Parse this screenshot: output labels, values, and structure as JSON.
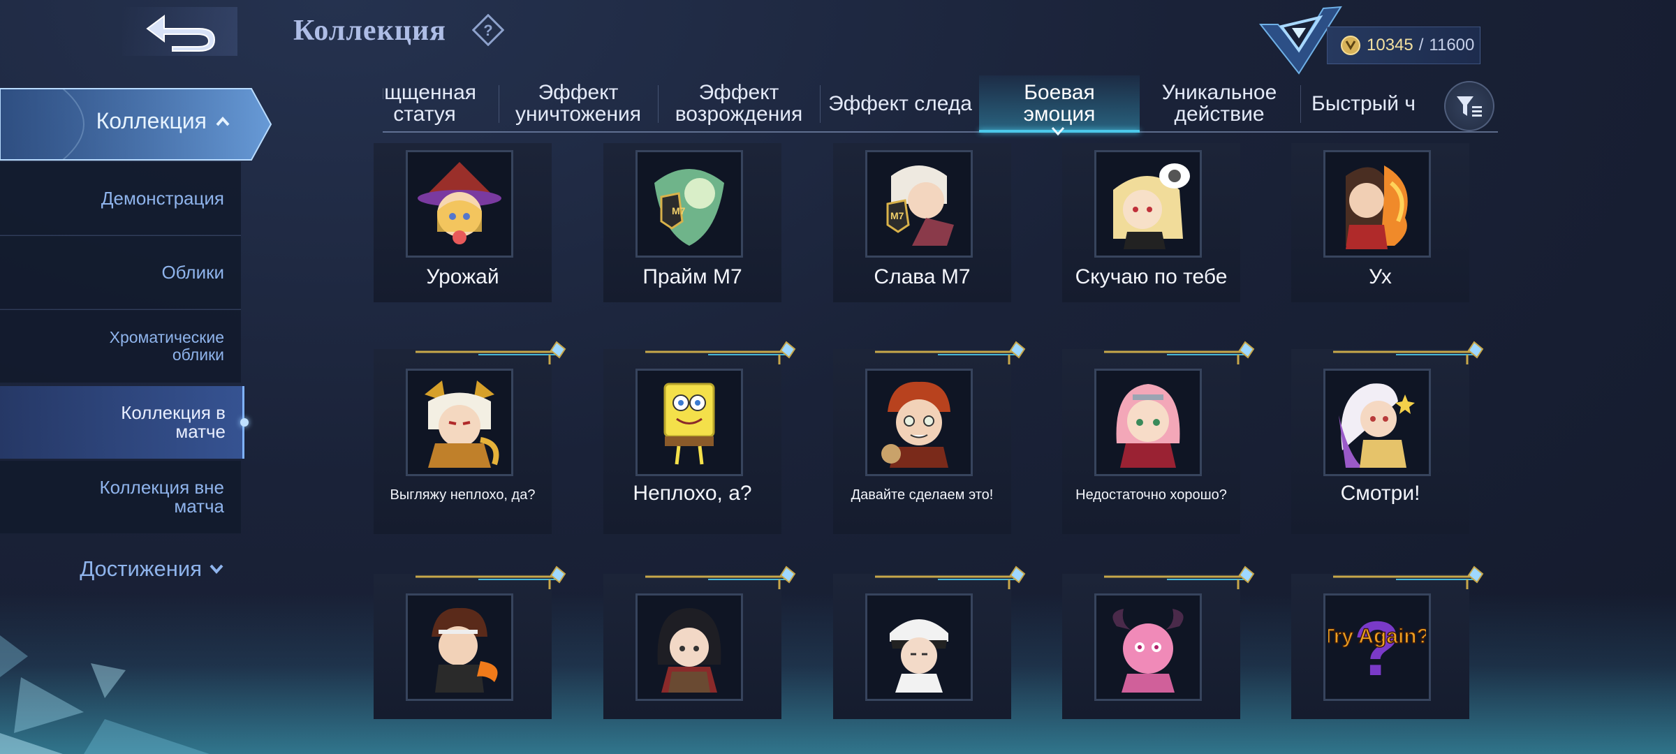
{
  "header": {
    "title": "Коллекция",
    "points_current": "10345",
    "points_separator": "/",
    "points_max": "11600"
  },
  "sidebar": {
    "active_section": "Коллекция",
    "items": [
      {
        "label": "Демонстрация"
      },
      {
        "label": "Облики"
      },
      {
        "label": "Хроматические облики"
      },
      {
        "label": "Коллекция в матче"
      },
      {
        "label": "Коллекция вне матча"
      }
    ],
    "achievements": "Достижения"
  },
  "tabs": [
    {
      "label": "ящщенная статуя"
    },
    {
      "label": "Эффект уничтожения"
    },
    {
      "label": "Эффект возрождения"
    },
    {
      "label": "Эффект следа"
    },
    {
      "label": "Боевая эмоция",
      "active": true
    },
    {
      "label": "Уникальное действие"
    },
    {
      "label": "Быстрый ч"
    }
  ],
  "emotes": [
    {
      "name": "Урожай",
      "icon": "witch-girl-sticker"
    },
    {
      "name": "Прайм М7",
      "icon": "m7-dragon-sticker"
    },
    {
      "name": "Слава М7",
      "icon": "m7-hero-sticker"
    },
    {
      "name": "Скучаю по тебе",
      "icon": "blonde-hero-sticker"
    },
    {
      "name": "Ух",
      "icon": "fire-hero-sticker"
    },
    {
      "name": "Выгляжу неплохо, да?",
      "icon": "oni-hero-sticker"
    },
    {
      "name": "Неплохо, а?",
      "icon": "spongebob-sticker"
    },
    {
      "name": "Давайте сделаем это!",
      "icon": "gaara-sticker"
    },
    {
      "name": "Недостаточно хорошо?",
      "icon": "sakura-sticker"
    },
    {
      "name": "Смотри!",
      "icon": "white-hair-hero-sticker"
    },
    {
      "name": "",
      "icon": "fire-fighter-sticker"
    },
    {
      "name": "",
      "icon": "mikasa-sticker"
    },
    {
      "name": "",
      "icon": "levi-sticker"
    },
    {
      "name": "",
      "icon": "pink-demon-sticker"
    },
    {
      "name": "",
      "icon": "try-again-sticker"
    }
  ],
  "try_again_text": "Try Again?",
  "colors": {
    "accent": "#4cc8ea",
    "sidebar_text": "#8fb4ec",
    "title": "#aebde6",
    "gold": "#c8a84a"
  }
}
